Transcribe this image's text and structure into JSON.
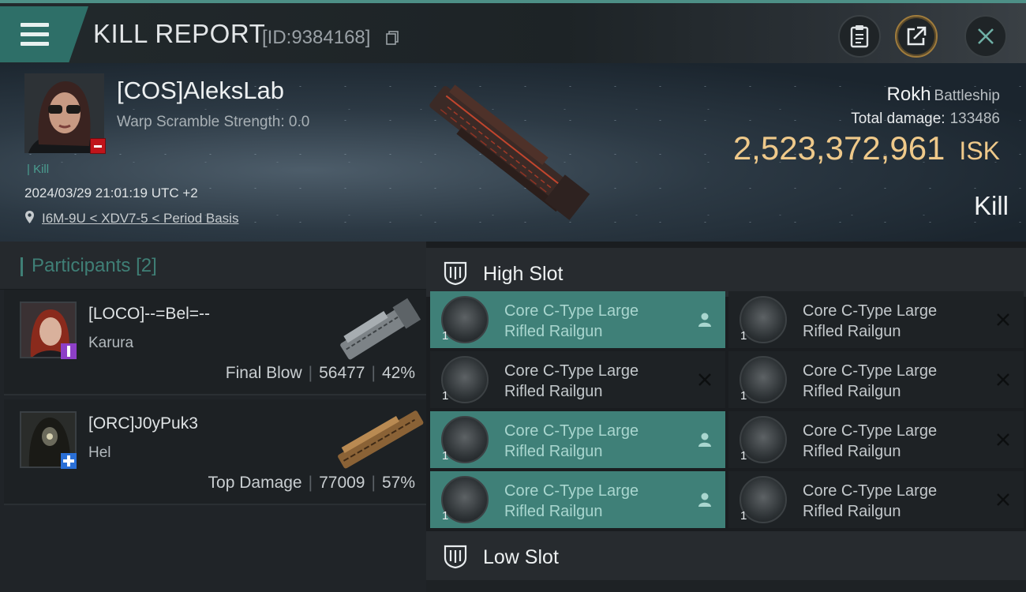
{
  "header": {
    "title": "KILL REPORT",
    "report_id": "[ID:9384168]",
    "icons": {
      "menu": "hamburger-menu-icon",
      "copy": "copy-icon",
      "clipboard": "clipboard-icon",
      "share": "share-icon",
      "close": "close-icon"
    }
  },
  "victim": {
    "name": "[COS]AleksLab",
    "warp_scramble": "Warp Scramble Strength: 0.0",
    "kill_tag": "Kill",
    "datetime": "2024/03/29 21:01:19 UTC +2",
    "location": "I6M-9U < XDV7-5 < Period Basis",
    "ship_name": "Rokh",
    "ship_class": "Battleship",
    "total_damage_label": "Total damage:",
    "total_damage": "133486",
    "isk_value": "2,523,372,961",
    "isk_unit": "ISK",
    "result": "Kill"
  },
  "participants": {
    "title": "Participants",
    "count": "[2]",
    "list": [
      {
        "name": "[LOCO]--=Bel=--",
        "ship": "Karura",
        "role": "Final Blow",
        "damage": "56477",
        "percent": "42%",
        "badge_color": "#8d3fc7"
      },
      {
        "name": "[ORC]J0yPuk3",
        "ship": "Hel",
        "role": "Top Damage",
        "damage": "77009",
        "percent": "57%",
        "badge_color": "#2a6fd6"
      }
    ]
  },
  "slots": {
    "high": {
      "label": "High Slot",
      "items": [
        {
          "qty": "1",
          "line1": "Core C-Type Large",
          "line2": "Rifled Railgun",
          "status": "used"
        },
        {
          "qty": "1",
          "line1": "Core C-Type Large",
          "line2": "Rifled Railgun",
          "status": "destroyed"
        },
        {
          "qty": "1",
          "line1": "Core C-Type Large",
          "line2": "Rifled Railgun",
          "status": "destroyed"
        },
        {
          "qty": "1",
          "line1": "Core C-Type Large",
          "line2": "Rifled Railgun",
          "status": "destroyed"
        },
        {
          "qty": "1",
          "line1": "Core C-Type Large",
          "line2": "Rifled Railgun",
          "status": "used"
        },
        {
          "qty": "1",
          "line1": "Core C-Type Large",
          "line2": "Rifled Railgun",
          "status": "destroyed"
        },
        {
          "qty": "1",
          "line1": "Core C-Type Large",
          "line2": "Rifled Railgun",
          "status": "used"
        },
        {
          "qty": "1",
          "line1": "Core C-Type Large",
          "line2": "Rifled Railgun",
          "status": "destroyed"
        }
      ]
    },
    "low": {
      "label": "Low Slot"
    }
  },
  "colors": {
    "accent_teal": "#3f8078",
    "isk_gold": "#efc98a",
    "badge_red": "#c0141b"
  }
}
